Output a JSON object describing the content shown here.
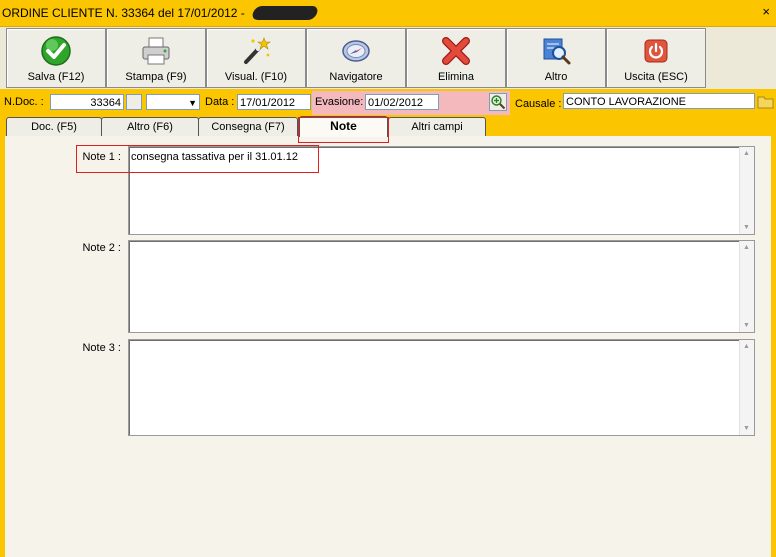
{
  "window": {
    "title": "ORDINE CLIENTE N. 33364  del 17/01/2012 -",
    "close_glyph": "×"
  },
  "toolbar": [
    {
      "label": "Salva (F12)",
      "icon": "check-icon"
    },
    {
      "label": "Stampa (F9)",
      "icon": "printer-icon"
    },
    {
      "label": "Visual. (F10)",
      "icon": "magic-wand-icon"
    },
    {
      "label": "Navigatore",
      "icon": "compass-icon"
    },
    {
      "label": "Elimina",
      "icon": "delete-x-icon"
    },
    {
      "label": "Altro",
      "icon": "search-doc-icon"
    },
    {
      "label": "Uscita (ESC)",
      "icon": "power-icon"
    }
  ],
  "fields": {
    "ndoc_label": "N.Doc. :",
    "ndoc_value": "33364",
    "data_label": "Data :",
    "data_value": "17/01/2012",
    "evasione_label": "Evasione:",
    "evasione_value": "01/02/2012",
    "causale_label": "Causale :",
    "causale_value": "CONTO LAVORAZIONE"
  },
  "tabs": [
    "Doc. (F5)",
    "Altro (F6)",
    "Consegna (F7)",
    "Note",
    "Altri campi"
  ],
  "active_tab": "Note",
  "notes": [
    {
      "label": "Note 1 :",
      "value": "consegna tassativa per il 31.01.12"
    },
    {
      "label": "Note 2 :",
      "value": ""
    },
    {
      "label": "Note 3 :",
      "value": ""
    }
  ],
  "colors": {
    "accent": "#fbc500",
    "highlight_pink": "#f4b9bd",
    "annotation_red": "#e02020"
  }
}
